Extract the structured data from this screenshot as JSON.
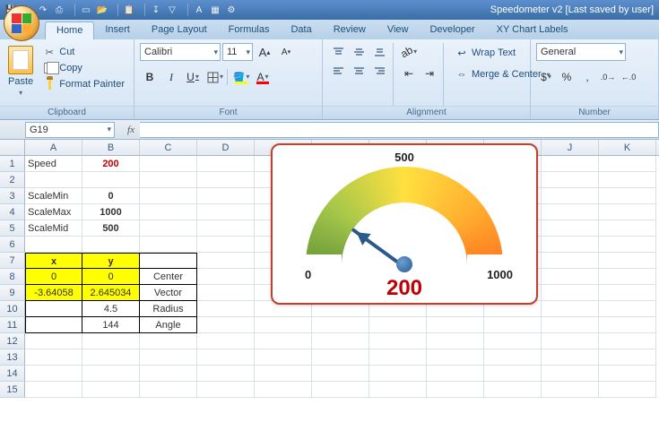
{
  "window": {
    "title": "Speedometer v2 [Last saved by user]"
  },
  "qat": [
    {
      "name": "save-icon",
      "glyph": "💾"
    },
    {
      "name": "undo-icon",
      "glyph": "↶"
    },
    {
      "name": "redo-icon",
      "glyph": "↷"
    },
    {
      "name": "print-icon",
      "glyph": "⎙"
    },
    {
      "name": "sep"
    },
    {
      "name": "new-icon",
      "glyph": "▭"
    },
    {
      "name": "open-icon",
      "glyph": "📂"
    },
    {
      "name": "sep"
    },
    {
      "name": "paste-icon",
      "glyph": "📋"
    },
    {
      "name": "sep"
    },
    {
      "name": "sort-icon",
      "glyph": "↧"
    },
    {
      "name": "filter-icon",
      "glyph": "▽"
    },
    {
      "name": "sep"
    },
    {
      "name": "a-icon",
      "glyph": "A"
    },
    {
      "name": "chart-icon",
      "glyph": "▦"
    },
    {
      "name": "calc-icon",
      "glyph": "⚙"
    }
  ],
  "tabs": [
    {
      "label": "Home",
      "active": true
    },
    {
      "label": "Insert"
    },
    {
      "label": "Page Layout"
    },
    {
      "label": "Formulas"
    },
    {
      "label": "Data"
    },
    {
      "label": "Review"
    },
    {
      "label": "View"
    },
    {
      "label": "Developer"
    },
    {
      "label": "XY Chart Labels"
    }
  ],
  "ribbon": {
    "clipboard": {
      "label": "Clipboard",
      "paste": "Paste",
      "cut": "Cut",
      "copy": "Copy",
      "painter": "Format Painter"
    },
    "font": {
      "label": "Font",
      "name": "Calibri",
      "size": "11"
    },
    "alignment": {
      "label": "Alignment",
      "wrap": "Wrap Text",
      "merge": "Merge & Center"
    },
    "number": {
      "label": "Number",
      "format": "General"
    }
  },
  "namebox": "G19",
  "columns": [
    "A",
    "B",
    "C",
    "D",
    "E",
    "F",
    "G",
    "H",
    "I",
    "J",
    "K"
  ],
  "rowcount": 15,
  "cells": {
    "A1": "Speed",
    "B1": "200",
    "A3": "ScaleMin",
    "B3": "0",
    "A4": "ScaleMax",
    "B4": "1000",
    "A5": "ScaleMid",
    "B5": "500",
    "A7": "x",
    "B7": "y",
    "A8": "0",
    "B8": "0",
    "C8": "Center",
    "A9": "-3.64058",
    "B9": "2.645034",
    "C9": "Vector",
    "B10": "4.5",
    "C10": "Radius",
    "B11": "144",
    "C11": "Angle"
  },
  "speedometer": {
    "min": "0",
    "max": "1000",
    "mid": "500",
    "value": "200"
  },
  "chart_data": {
    "type": "gauge",
    "title": "",
    "min": 0,
    "max": 1000,
    "mid": 500,
    "value": 200,
    "needle_angle_deg": 144,
    "needle_radius": 4.5,
    "needle_vector": {
      "x": -3.64058,
      "y": 2.645034
    },
    "arc_range_deg": [
      0,
      180
    ],
    "tick_labels": [
      {
        "pos": 0,
        "label": "0"
      },
      {
        "pos": 500,
        "label": "500"
      },
      {
        "pos": 1000,
        "label": "1000"
      }
    ],
    "color_stops": [
      {
        "deg": 0,
        "color": "#6a9a3a"
      },
      {
        "deg": 40,
        "color": "#a8c84a"
      },
      {
        "deg": 90,
        "color": "#ffe040"
      },
      {
        "deg": 140,
        "color": "#ffb030"
      },
      {
        "deg": 180,
        "color": "#ff7a20"
      }
    ]
  }
}
